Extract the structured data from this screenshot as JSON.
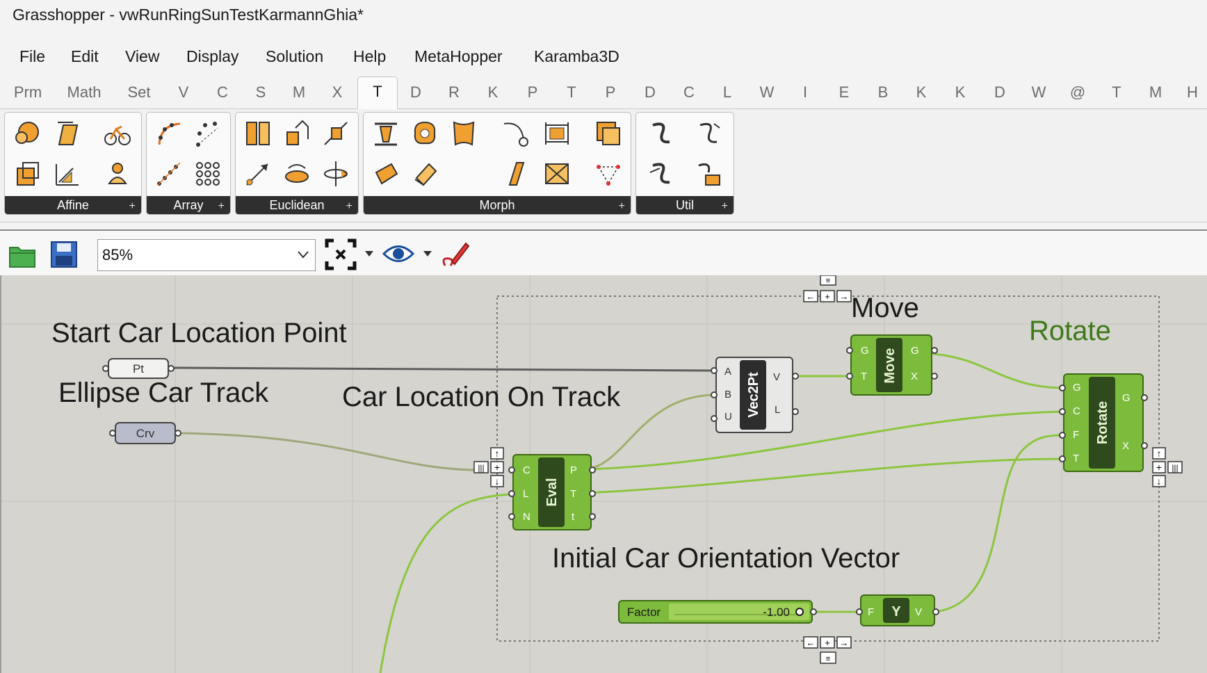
{
  "window": {
    "title": "Grasshopper - vwRunRingSunTestKarmannGhia*"
  },
  "menu": [
    "File",
    "Edit",
    "View",
    "Display",
    "Solution",
    "Help",
    "MetaHopper",
    "Karamba3D"
  ],
  "tabs": [
    "Prm",
    "Math",
    "Set",
    "V",
    "C",
    "S",
    "M",
    "X",
    "T",
    "D",
    "R",
    "K",
    "P",
    "T",
    "P",
    "D",
    "C",
    "L",
    "W",
    "I",
    "E",
    "B",
    "K",
    "K",
    "D",
    "W",
    "@",
    "T",
    "M",
    "H"
  ],
  "active_tab": "T",
  "ribbon": {
    "panels": [
      "Affine",
      "Array",
      "Euclidean",
      "Morph",
      "Util"
    ]
  },
  "canvas_toolbar": {
    "zoom": "85%"
  },
  "canvas": {
    "groups": {
      "start_point": "Start Car Location Point",
      "ellipse": "Ellipse Car Track",
      "location": "Car Location On Track",
      "move": "Move",
      "rotate": "Rotate",
      "orientation": "Initial Car Orientation Vector"
    },
    "components": {
      "pt": "Pt",
      "crv": "Crv",
      "vec2pt": {
        "name": "Vec2Pt",
        "inputs": [
          "A",
          "B",
          "U"
        ],
        "outputs": [
          "V",
          "L"
        ]
      },
      "move": {
        "name": "Move",
        "inputs": [
          "G",
          "T"
        ],
        "outputs": [
          "G",
          "X"
        ]
      },
      "eval": {
        "name": "Eval",
        "inputs": [
          "C",
          "L",
          "N"
        ],
        "outputs": [
          "P",
          "T",
          "t"
        ]
      },
      "rotate": {
        "name": "Rotate",
        "inputs": [
          "G",
          "C",
          "F",
          "T"
        ],
        "outputs": [
          "G",
          "X"
        ]
      },
      "yvec": {
        "name": "Y",
        "inputs": [
          "F"
        ],
        "outputs": [
          "V"
        ]
      },
      "slider": {
        "label": "Factor",
        "value": "-1.00"
      }
    },
    "colors": {
      "wire_selected": "#8cc63f",
      "wire_plain": "#6b6b6b",
      "component_green": "#7dbb3c",
      "canvas_bg": "#d5d4cf"
    }
  }
}
